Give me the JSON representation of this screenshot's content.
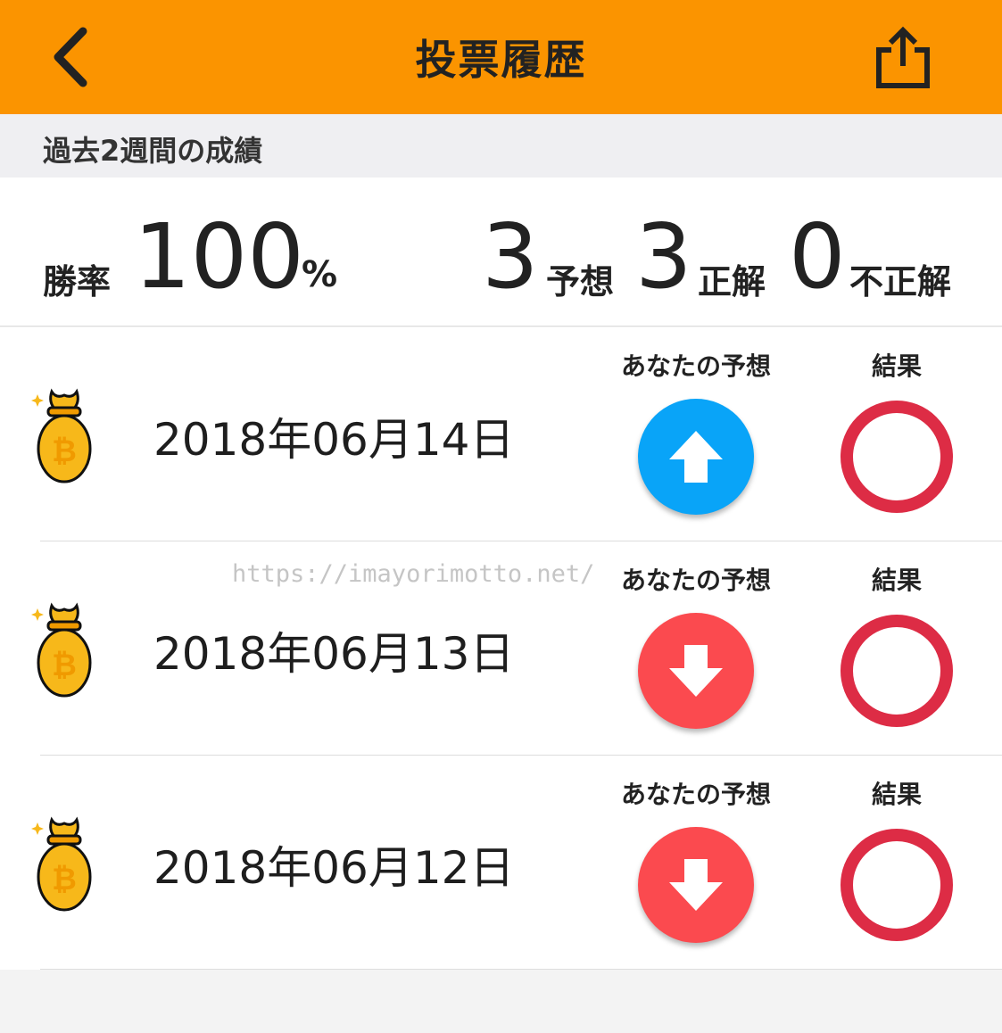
{
  "header": {
    "title": "投票履歴",
    "back_icon": "chevron-left-icon",
    "share_icon": "share-icon",
    "color": "#fb9400"
  },
  "section": {
    "label": "過去2週間の成績"
  },
  "stats": {
    "win_rate_label": "勝率",
    "win_rate_value": "100",
    "win_rate_unit": "%",
    "predictions_count": "3",
    "predictions_label": "予想",
    "correct_count": "3",
    "correct_label": "正解",
    "incorrect_count": "0",
    "incorrect_label": "不正解"
  },
  "columns": {
    "prediction": "あなたの予想",
    "result": "結果"
  },
  "rows": [
    {
      "date": "2018年06月14日",
      "prediction": "up",
      "prediction_color": "#09a4f8",
      "result": "correct",
      "icon": "bitcoin-bag-icon"
    },
    {
      "date": "2018年06月13日",
      "prediction": "down",
      "prediction_color": "#fb4a4f",
      "result": "correct",
      "icon": "bitcoin-bag-icon"
    },
    {
      "date": "2018年06月12日",
      "prediction": "down",
      "prediction_color": "#fb4a4f",
      "result": "correct",
      "icon": "bitcoin-bag-icon"
    }
  ],
  "result_color": "#dd2c45",
  "watermark": "https://imayorimotto.net/"
}
